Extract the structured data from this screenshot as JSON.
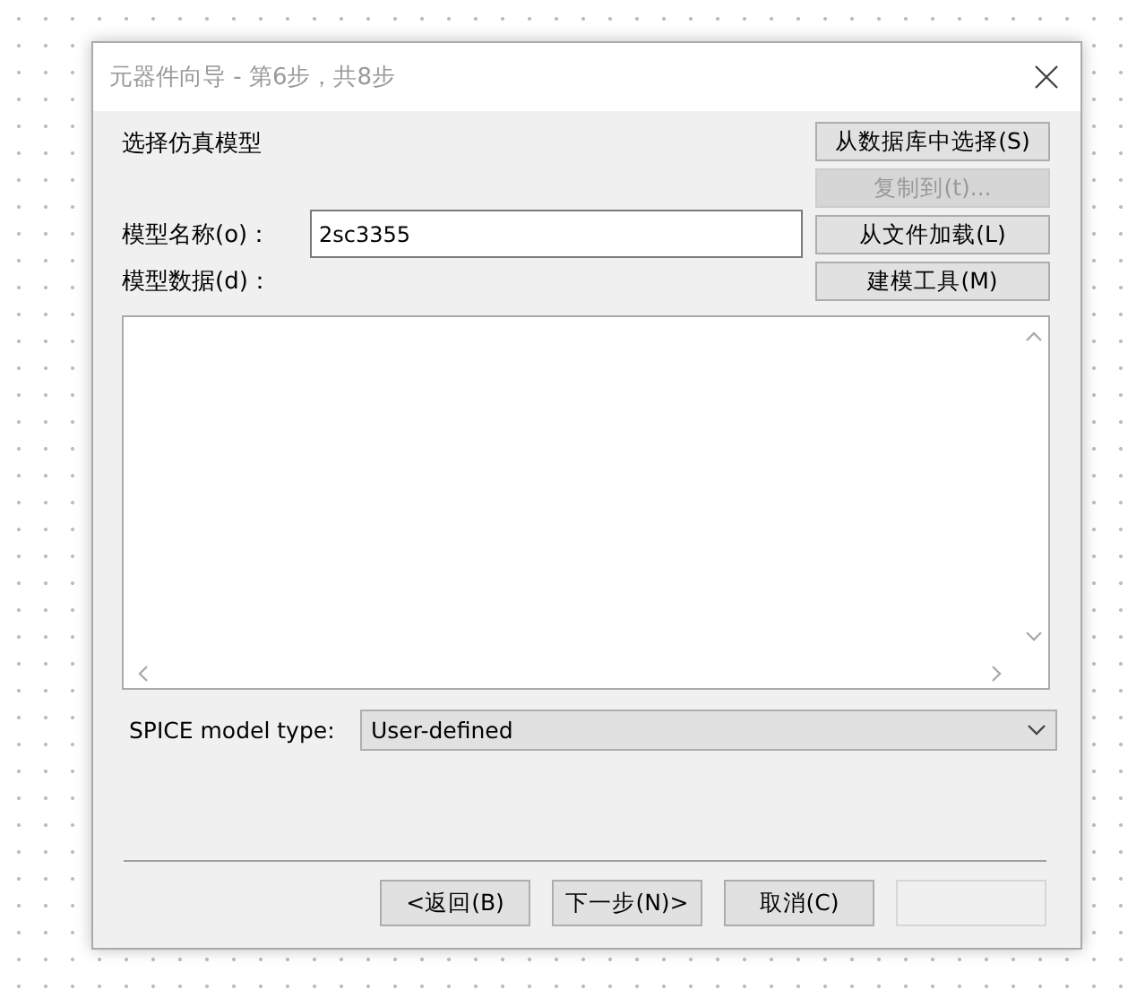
{
  "window": {
    "title": "元器件向导 - 第6步，共8步"
  },
  "heading": "选择仿真模型",
  "side_buttons": [
    {
      "label": "从数据库中选择(S)",
      "disabled": false
    },
    {
      "label": "复制到(t)...",
      "disabled": true
    },
    {
      "label": "从文件加载(L)",
      "disabled": false
    },
    {
      "label": "建模工具(M)",
      "disabled": false
    }
  ],
  "model_name": {
    "label": "模型名称(o)：",
    "value": "2sc3355"
  },
  "model_data": {
    "label": "模型数据(d)："
  },
  "spice_type": {
    "label": "SPICE model type:",
    "value": "User-defined"
  },
  "footer_buttons": [
    {
      "label": "<返回(B)",
      "disabled": false
    },
    {
      "label": "下一步(N)>",
      "disabled": false
    },
    {
      "label": "取消(C)",
      "disabled": false
    },
    {
      "disabled": true
    }
  ]
}
